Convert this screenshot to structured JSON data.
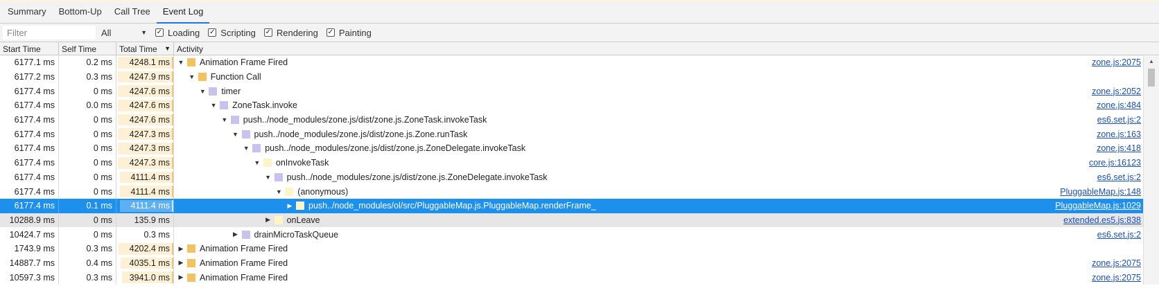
{
  "tabs": [
    {
      "label": "Summary"
    },
    {
      "label": "Bottom-Up"
    },
    {
      "label": "Call Tree"
    },
    {
      "label": "Event Log",
      "active": true
    }
  ],
  "filterbar": {
    "filter_placeholder": "Filter",
    "select_value": "All",
    "checkboxes": [
      {
        "label": "Loading",
        "checked": true
      },
      {
        "label": "Scripting",
        "checked": true
      },
      {
        "label": "Rendering",
        "checked": true
      },
      {
        "label": "Painting",
        "checked": true
      }
    ]
  },
  "columns": {
    "start": "Start Time",
    "self": "Self Time",
    "total": "Total Time",
    "activity": "Activity"
  },
  "colors": {
    "scripting": "#f2c360",
    "timer": "#c9c2f0",
    "invoke": "#fbf5c8",
    "selection": "#1d8fed"
  },
  "rows": [
    {
      "start": "6177.1 ms",
      "self": "0.2 ms",
      "total": "4248.1 ms",
      "total_fraction": 1.0,
      "level": 0,
      "toggle": "expanded",
      "color": "#f2c360",
      "name": "Animation Frame Fired",
      "link": "zone.js:2075"
    },
    {
      "start": "6177.2 ms",
      "self": "0.3 ms",
      "total": "4247.9 ms",
      "total_fraction": 1.0,
      "level": 1,
      "toggle": "expanded",
      "color": "#f2c360",
      "name": "Function Call",
      "link": ""
    },
    {
      "start": "6177.4 ms",
      "self": "0 ms",
      "total": "4247.6 ms",
      "total_fraction": 1.0,
      "level": 2,
      "toggle": "expanded",
      "color": "#c9c2f0",
      "name": "timer",
      "link": "zone.js:2052"
    },
    {
      "start": "6177.4 ms",
      "self": "0.0 ms",
      "total": "4247.6 ms",
      "total_fraction": 1.0,
      "level": 3,
      "toggle": "expanded",
      "color": "#c9c2f0",
      "name": "ZoneTask.invoke",
      "link": "zone.js:484"
    },
    {
      "start": "6177.4 ms",
      "self": "0 ms",
      "total": "4247.6 ms",
      "total_fraction": 1.0,
      "level": 4,
      "toggle": "expanded",
      "color": "#c9c2f0",
      "name": "push../node_modules/zone.js/dist/zone.js.ZoneTask.invokeTask",
      "link": "es6.set.js:2"
    },
    {
      "start": "6177.4 ms",
      "self": "0 ms",
      "total": "4247.3 ms",
      "total_fraction": 1.0,
      "level": 5,
      "toggle": "expanded",
      "color": "#c9c2f0",
      "name": "push../node_modules/zone.js/dist/zone.js.Zone.runTask",
      "link": "zone.js:163"
    },
    {
      "start": "6177.4 ms",
      "self": "0 ms",
      "total": "4247.3 ms",
      "total_fraction": 1.0,
      "level": 6,
      "toggle": "expanded",
      "color": "#c9c2f0",
      "name": "push../node_modules/zone.js/dist/zone.js.ZoneDelegate.invokeTask",
      "link": "zone.js:418"
    },
    {
      "start": "6177.4 ms",
      "self": "0 ms",
      "total": "4247.3 ms",
      "total_fraction": 1.0,
      "level": 7,
      "toggle": "expanded",
      "color": "#fbf5c8",
      "name": "onInvokeTask",
      "link": "core.js:16123"
    },
    {
      "start": "6177.4 ms",
      "self": "0 ms",
      "total": "4111.4 ms",
      "total_fraction": 0.968,
      "level": 8,
      "toggle": "expanded",
      "color": "#c9c2f0",
      "name": "push../node_modules/zone.js/dist/zone.js.ZoneDelegate.invokeTask",
      "link": "es6.set.js:2"
    },
    {
      "start": "6177.4 ms",
      "self": "0 ms",
      "total": "4111.4 ms",
      "total_fraction": 0.968,
      "level": 9,
      "toggle": "expanded",
      "color": "#fbf5c8",
      "name": "(anonymous)",
      "link": "PluggableMap.js:148"
    },
    {
      "start": "6177.4 ms",
      "self": "0.1 ms",
      "total": "4111.4 ms",
      "total_fraction": 0.968,
      "level": 10,
      "toggle": "collapsed",
      "color": "#fbf5c8",
      "name": "push../node_modules/ol/src/PluggableMap.js.PluggableMap.renderFrame_",
      "link": "PluggableMap.js:1029",
      "selected": true
    },
    {
      "start": "10288.9 ms",
      "self": "0 ms",
      "total": "135.9 ms",
      "total_fraction": 0.0,
      "level": 8,
      "toggle": "collapsed",
      "color": "#fbf5c8",
      "name": "onLeave",
      "link": "extended.es5.js:838",
      "hovered": true
    },
    {
      "start": "10424.7 ms",
      "self": "0 ms",
      "total": "0.3 ms",
      "total_fraction": 0.0,
      "level": 5,
      "toggle": "collapsed",
      "color": "#c9c2f0",
      "name": "drainMicroTaskQueue",
      "link": "es6.set.js:2"
    },
    {
      "start": "1743.9 ms",
      "self": "0.3 ms",
      "total": "4202.4 ms",
      "total_fraction": 0.989,
      "level": 0,
      "toggle": "collapsed",
      "color": "#f2c360",
      "name": "Animation Frame Fired",
      "link": ""
    },
    {
      "start": "14887.7 ms",
      "self": "0.4 ms",
      "total": "4035.1 ms",
      "total_fraction": 0.95,
      "level": 0,
      "toggle": "collapsed",
      "color": "#f2c360",
      "name": "Animation Frame Fired",
      "link": "zone.js:2075"
    },
    {
      "start": "10597.3 ms",
      "self": "0.3 ms",
      "total": "3941.0 ms",
      "total_fraction": 0.928,
      "level": 0,
      "toggle": "collapsed",
      "color": "#f2c360",
      "name": "Animation Frame Fired",
      "link": "zone.js:2075"
    }
  ]
}
